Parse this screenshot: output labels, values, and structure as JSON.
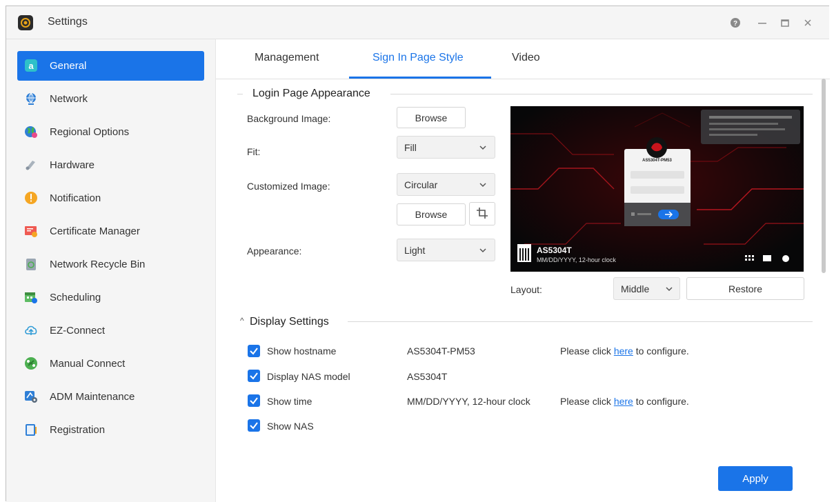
{
  "window": {
    "title": "Settings"
  },
  "sidebar": {
    "items": [
      {
        "label": "General",
        "icon": "general-icon"
      },
      {
        "label": "Network",
        "icon": "globe-icon"
      },
      {
        "label": "Regional Options",
        "icon": "regional-icon"
      },
      {
        "label": "Hardware",
        "icon": "hardware-icon"
      },
      {
        "label": "Notification",
        "icon": "notification-icon"
      },
      {
        "label": "Certificate Manager",
        "icon": "certificate-icon"
      },
      {
        "label": "Network Recycle Bin",
        "icon": "recycle-bin-icon"
      },
      {
        "label": "Scheduling",
        "icon": "calendar-icon"
      },
      {
        "label": "EZ-Connect",
        "icon": "cloud-icon"
      },
      {
        "label": "Manual Connect",
        "icon": "connect-icon"
      },
      {
        "label": "ADM Maintenance",
        "icon": "maintenance-icon"
      },
      {
        "label": "Registration",
        "icon": "registration-icon"
      }
    ],
    "active_index": 0
  },
  "tabs": [
    {
      "label": "Management"
    },
    {
      "label": "Sign In Page Style"
    },
    {
      "label": "Video"
    }
  ],
  "login_appearance": {
    "heading": "Login Page Appearance",
    "background_label": "Background Image:",
    "browse_label": "Browse",
    "fit_label": "Fit:",
    "fit_value": "Fill",
    "customized_label": "Customized Image:",
    "customized_value": "Circular",
    "browse2_label": "Browse",
    "appearance_label": "Appearance:",
    "appearance_value": "Light",
    "layout_label": "Layout:",
    "layout_value": "Middle",
    "restore_label": "Restore"
  },
  "preview": {
    "hostname": "AS5304T-PM53",
    "model": "AS5304T",
    "time_format": "MM/DD/YYYY, 12-hour clock"
  },
  "display_settings": {
    "heading": "Display Settings",
    "rows": [
      {
        "label": "Show hostname",
        "value": "AS5304T-PM53",
        "hint_pre": "Please click ",
        "hint_link": "here",
        "hint_post": " to configure."
      },
      {
        "label": "Display NAS model",
        "value": "AS5304T",
        "hint_pre": "",
        "hint_link": "",
        "hint_post": ""
      },
      {
        "label": "Show time",
        "value": "MM/DD/YYYY, 12-hour clock",
        "hint_pre": "Please click ",
        "hint_link": "here",
        "hint_post": " to configure."
      },
      {
        "label": "Show NAS",
        "value": "",
        "hint_pre": "",
        "hint_link": "",
        "hint_post": ""
      }
    ]
  },
  "apply_label": "Apply",
  "colors": {
    "accent": "#1a74e8",
    "sidebar_bg": "#f5f5f5"
  }
}
